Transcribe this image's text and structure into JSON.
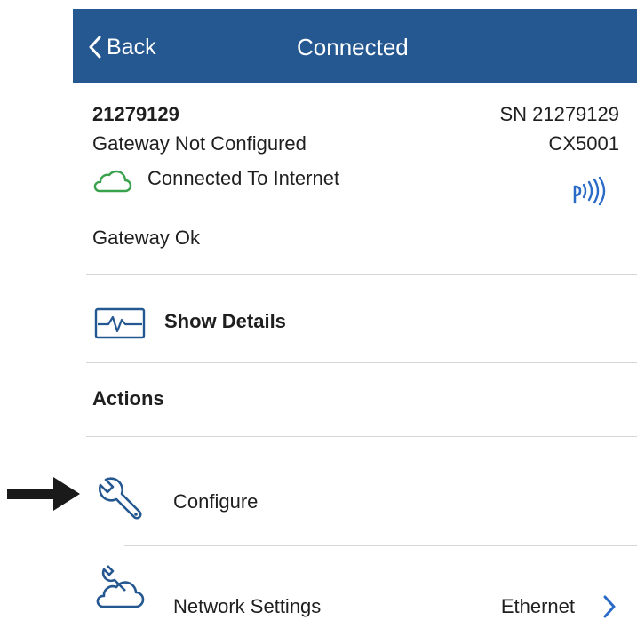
{
  "navbar": {
    "back_label": "Back",
    "title": "Connected"
  },
  "device": {
    "id": "21279129",
    "serial": "SN 21279129",
    "status": "Gateway Not Configured",
    "model": "CX5001",
    "internet": "Connected To Internet",
    "health": "Gateway Ok"
  },
  "details": {
    "label": "Show Details"
  },
  "actions": {
    "heading": "Actions",
    "configure_label": "Configure",
    "network_label": "Network Settings",
    "network_value": "Ethernet"
  },
  "colors": {
    "navbar": "#255891",
    "accent": "#2a6bc7",
    "cloud": "#3aa14d"
  },
  "icons": [
    "chevron-left-icon",
    "cloud-icon",
    "signal-icon",
    "pulse-icon",
    "wrench-icon",
    "network-cloud-icon",
    "chevron-right-icon",
    "pointer-arrow-icon"
  ]
}
